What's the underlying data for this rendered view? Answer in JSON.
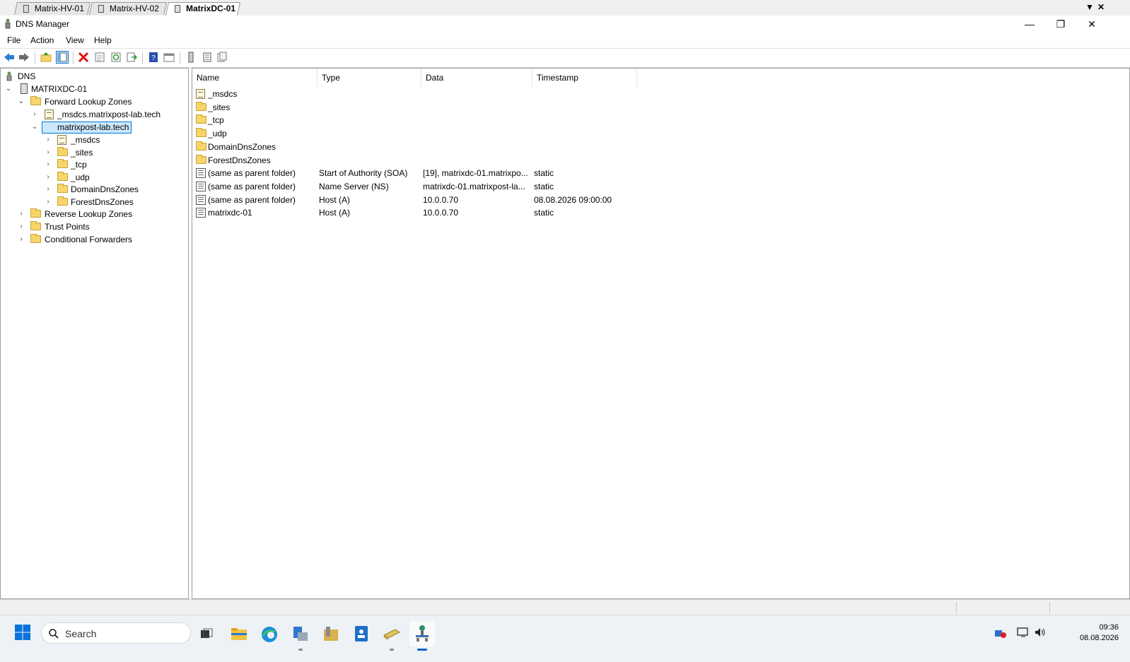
{
  "rdp_tabs": [
    "Matrix-HV-01",
    "Matrix-HV-02",
    "MatrixDC-01"
  ],
  "rdp_active_tab": "MatrixDC-01",
  "window": {
    "title": "DNS Manager",
    "minimize": "—",
    "restore": "❐",
    "close": "✕"
  },
  "menu": {
    "file": "File",
    "action": "Action",
    "view": "View",
    "help": "Help"
  },
  "tree": {
    "root": "DNS",
    "server": "MATRIXDC-01",
    "forward": "Forward Lookup Zones",
    "msdcs_zone": "_msdcs.matrixpost-lab.tech",
    "main_zone": "matrixpost-lab.tech",
    "children": [
      "_msdcs",
      "_sites",
      "_tcp",
      "_udp",
      "DomainDnsZones",
      "ForestDnsZones"
    ],
    "reverse": "Reverse Lookup Zones",
    "trust": "Trust Points",
    "conditional": "Conditional Forwarders"
  },
  "columns": {
    "name": "Name",
    "type": "Type",
    "data": "Data",
    "timestamp": "Timestamp"
  },
  "records": [
    {
      "name": "_msdcs",
      "type": "",
      "data": "",
      "timestamp": "",
      "icon": "delegation"
    },
    {
      "name": "_sites",
      "type": "",
      "data": "",
      "timestamp": "",
      "icon": "folder"
    },
    {
      "name": "_tcp",
      "type": "",
      "data": "",
      "timestamp": "",
      "icon": "folder"
    },
    {
      "name": "_udp",
      "type": "",
      "data": "",
      "timestamp": "",
      "icon": "folder"
    },
    {
      "name": "DomainDnsZones",
      "type": "",
      "data": "",
      "timestamp": "",
      "icon": "folder"
    },
    {
      "name": "ForestDnsZones",
      "type": "",
      "data": "",
      "timestamp": "",
      "icon": "folder"
    },
    {
      "name": "(same as parent folder)",
      "type": "Start of Authority (SOA)",
      "data": "[19], matrixdc-01.matrixpo...",
      "timestamp": "static",
      "icon": "record"
    },
    {
      "name": "(same as parent folder)",
      "type": "Name Server (NS)",
      "data": "matrixdc-01.matrixpost-la...",
      "timestamp": "static",
      "icon": "record"
    },
    {
      "name": "(same as parent folder)",
      "type": "Host (A)",
      "data": "10.0.0.70",
      "timestamp": "08.08.2026 09:00:00",
      "icon": "record"
    },
    {
      "name": "matrixdc-01",
      "type": "Host (A)",
      "data": "10.0.0.70",
      "timestamp": "static",
      "icon": "record"
    }
  ],
  "taskbar": {
    "search_placeholder": "Search",
    "time": "09:36",
    "date": "08.08.2026"
  },
  "colors": {
    "accent": "#0078d7",
    "folder": "#f7d56a",
    "selection": "#cce8ff"
  }
}
